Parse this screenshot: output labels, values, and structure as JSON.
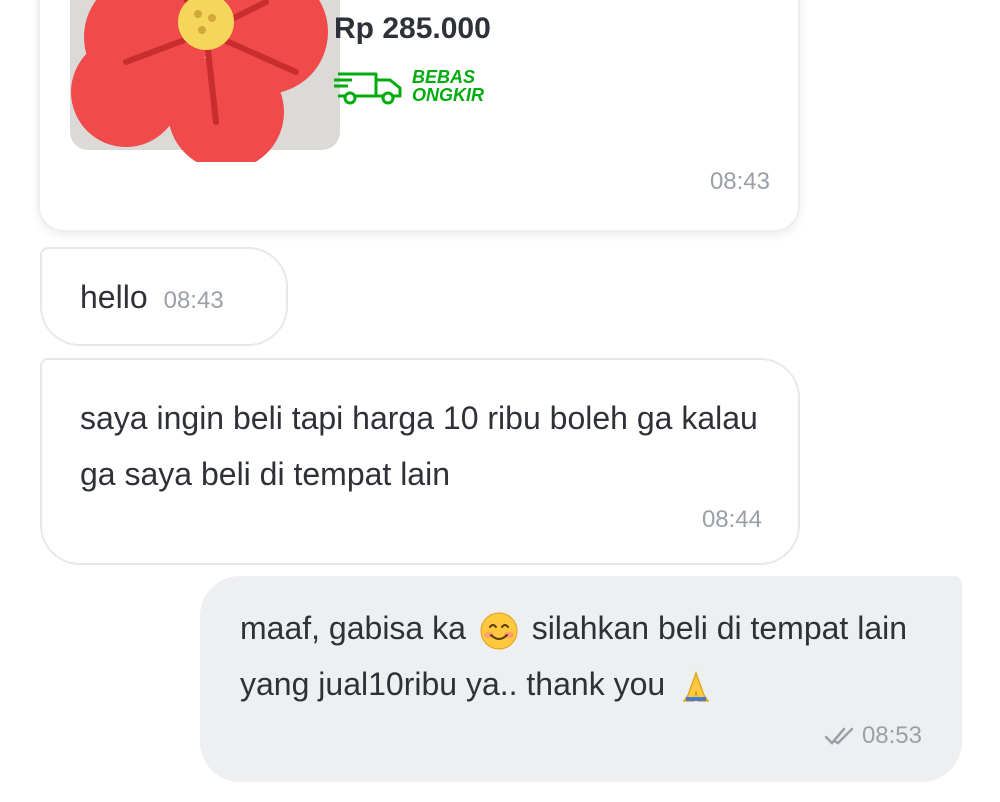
{
  "product": {
    "price": "Rp 285.000",
    "free_shipping_line1": "BEBAS",
    "free_shipping_line2": "ONGKIR",
    "time": "08:43"
  },
  "messages": [
    {
      "direction": "incoming",
      "text": "hello",
      "time": "08:43"
    },
    {
      "direction": "incoming",
      "text": "saya ingin beli tapi harga 10 ribu boleh ga kalau ga saya beli di tempat lain",
      "time": "08:44"
    },
    {
      "direction": "outgoing",
      "text_part1": "maaf, gabisa ka",
      "text_part2": "silahkan beli di tempat lain yang jual10ribu ya.. thank you",
      "time": "08:53",
      "status": "read-double-check-icon"
    }
  ],
  "colors": {
    "brand_green": "#03ac0e",
    "bubble_out_bg": "#eeeff1",
    "text": "#2e3137",
    "time_gray": "#9aa0a6"
  }
}
